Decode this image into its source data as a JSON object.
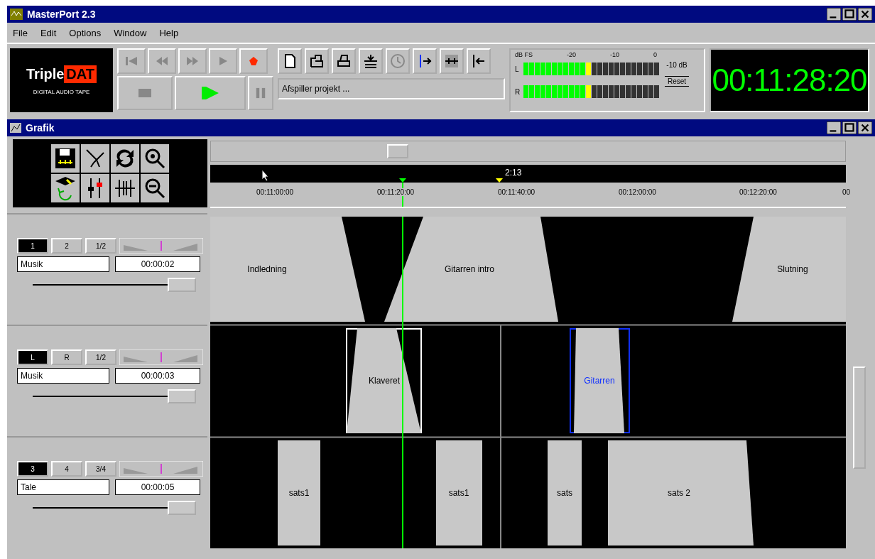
{
  "window": {
    "title": "MasterPort 2.3"
  },
  "menu": [
    "File",
    "Edit",
    "Options",
    "Window",
    "Help"
  ],
  "logo": {
    "name": "Triple",
    "highlight": "DAT",
    "subtitle": "DIGITAL AUDIO TAPE"
  },
  "transport": [
    {
      "kind": "first",
      "disabled": true
    },
    {
      "kind": "rewind",
      "disabled": true
    },
    {
      "kind": "forward",
      "disabled": true
    },
    {
      "kind": "play",
      "disabled": true
    },
    {
      "kind": "record",
      "disabled": false
    },
    {
      "kind": "stop",
      "disabled": true
    },
    {
      "kind": "play-big",
      "disabled": false
    },
    {
      "kind": "pause",
      "disabled": true
    }
  ],
  "tools": [
    {
      "kind": "page",
      "disabled": false
    },
    {
      "kind": "open",
      "disabled": false
    },
    {
      "kind": "print",
      "disabled": false
    },
    {
      "kind": "merge",
      "disabled": false
    },
    {
      "kind": "clock",
      "disabled": true
    },
    {
      "kind": "split",
      "disabled": false
    },
    {
      "kind": "grid",
      "disabled": false
    },
    {
      "kind": "back",
      "disabled": false
    }
  ],
  "status": "Afspiller projekt ...",
  "meters": {
    "scale": [
      "dB FS",
      "-20",
      "-10",
      "0"
    ],
    "channels": [
      {
        "label": "L",
        "level": 0.5
      },
      {
        "label": "R",
        "level": 0.5
      }
    ],
    "reading": "-10 dB",
    "reset_button": "Reset"
  },
  "clock": "00:11:28:20",
  "graphics_window": {
    "title": "Grafik"
  },
  "ruler": {
    "ticks": [
      "00:11:00:00",
      "00:11:20:00",
      "00:11:40:00",
      "00:12:00:00",
      "00:12:20:00",
      "00"
    ],
    "marker_label": "2:13"
  },
  "tracks": [
    {
      "buttons": [
        {
          "label": "1",
          "selected": true
        },
        {
          "label": "2",
          "selected": false
        },
        {
          "label": "1/2",
          "selected": false
        }
      ],
      "name": "Musik",
      "time": "00:00:02",
      "level": 1,
      "clips": [
        {
          "label": "Indledning",
          "selected": false
        },
        {
          "label": "Gitarren intro",
          "selected": false
        },
        {
          "label": "Slutning",
          "selected": false
        }
      ]
    },
    {
      "buttons": [
        {
          "label": "L",
          "selected": true
        },
        {
          "label": "R",
          "selected": false
        },
        {
          "label": "1/2",
          "selected": false
        }
      ],
      "name": "Musik",
      "time": "00:00:03",
      "level": 1,
      "clips": [
        {
          "label": "Klaveret",
          "selected": false
        },
        {
          "label": "Gitarren",
          "selected": true
        }
      ]
    },
    {
      "buttons": [
        {
          "label": "3",
          "selected": true
        },
        {
          "label": "4",
          "selected": false
        },
        {
          "label": "3/4",
          "selected": false
        }
      ],
      "name": "Tale",
      "time": "00:00:05",
      "level": 1,
      "clips": [
        {
          "label": "sats1",
          "selected": false
        },
        {
          "label": "sats1",
          "selected": false
        },
        {
          "label": "sats",
          "selected": false
        },
        {
          "label": "sats 2",
          "selected": false
        }
      ]
    }
  ]
}
